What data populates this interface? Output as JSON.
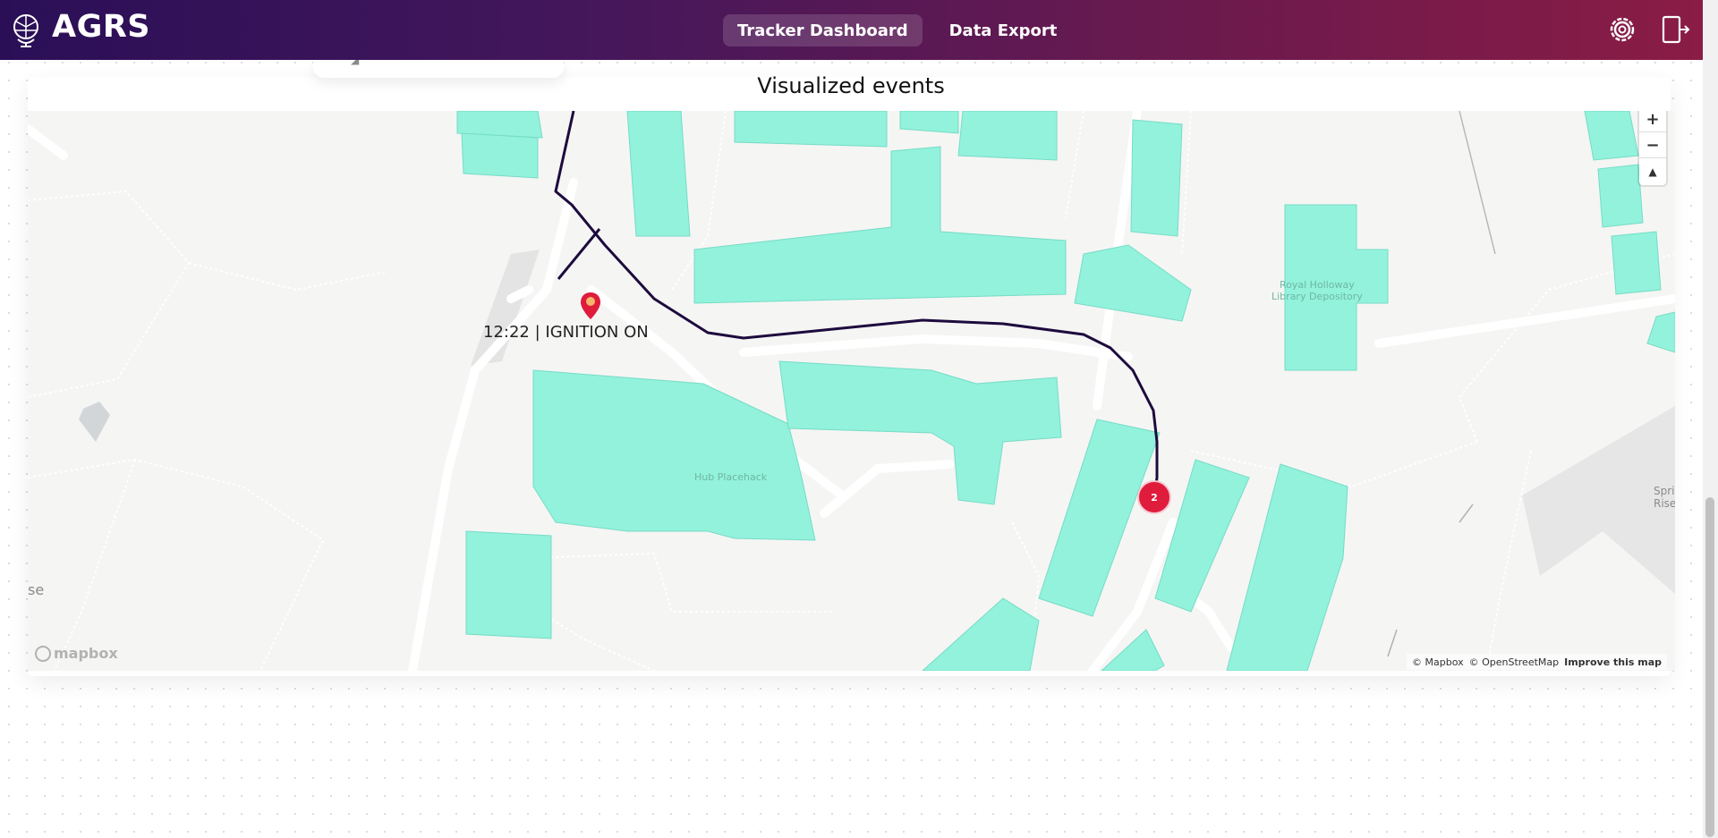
{
  "app": {
    "name": "AGRS"
  },
  "nav": {
    "tabs": [
      {
        "label": "Tracker Dashboard",
        "active": true
      },
      {
        "label": "Data Export",
        "active": false
      }
    ]
  },
  "header_icons": [
    "settings-icon",
    "logout-icon"
  ],
  "card": {
    "title": "Visualized events"
  },
  "map": {
    "event_popup": "12:22 | IGNITION ON",
    "cluster_count": "2",
    "building_labels": {
      "hub": "Hub Placehack",
      "library": "Royal Holloway\nLibrary Depository"
    },
    "street_labels": {
      "right": "Spring Rise",
      "left": "se"
    },
    "controls": {
      "zoom_in": "+",
      "zoom_out": "−",
      "compass": "▲"
    },
    "logo": "mapbox",
    "attribution": {
      "mapbox": "© Mapbox",
      "osm": "© OpenStreetMap",
      "improve": "Improve this map"
    }
  },
  "colors": {
    "header_start": "#2a0f57",
    "header_end": "#8a1c45",
    "building": "#92f2dc",
    "building_shade": "#6fcfba",
    "route": "#1d0b3d",
    "marker": "#e01c3d"
  }
}
